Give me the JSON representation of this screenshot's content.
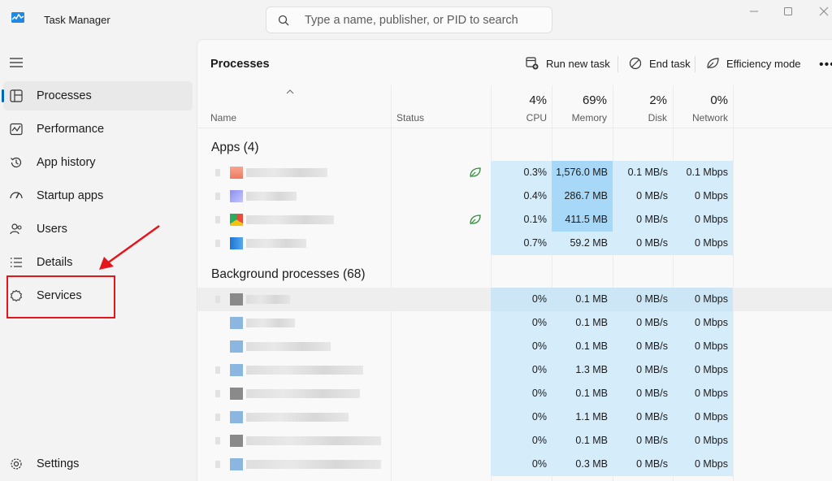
{
  "window": {
    "title": "Task Manager",
    "search_placeholder": "Type a name, publisher, or PID to search"
  },
  "sidebar": {
    "items": [
      {
        "label": "Processes",
        "icon": "processes-icon",
        "selected": true
      },
      {
        "label": "Performance",
        "icon": "performance-icon"
      },
      {
        "label": "App history",
        "icon": "history-icon"
      },
      {
        "label": "Startup apps",
        "icon": "startup-icon"
      },
      {
        "label": "Users",
        "icon": "users-icon"
      },
      {
        "label": "Details",
        "icon": "details-icon"
      },
      {
        "label": "Services",
        "icon": "services-icon"
      }
    ],
    "settings_label": "Settings"
  },
  "toolbar": {
    "page_title": "Processes",
    "run_new_task": "Run new task",
    "end_task": "End task",
    "efficiency_mode": "Efficiency mode",
    "more": "•••"
  },
  "columns": {
    "name": "Name",
    "status": "Status",
    "cpu": {
      "pct": "4%",
      "label": "CPU"
    },
    "memory": {
      "pct": "69%",
      "label": "Memory"
    },
    "disk": {
      "pct": "2%",
      "label": "Disk"
    },
    "network": {
      "pct": "0%",
      "label": "Network"
    }
  },
  "apps": {
    "header": "Apps (4)",
    "rows": [
      {
        "cpu": "0.3%",
        "memory": "1,576.0 MB",
        "disk": "0.1 MB/s",
        "network": "0.1 Mbps",
        "efficiency": true,
        "mem_heat": "high"
      },
      {
        "cpu": "0.4%",
        "memory": "286.7 MB",
        "disk": "0 MB/s",
        "network": "0 Mbps",
        "efficiency": false,
        "mem_heat": "high"
      },
      {
        "cpu": "0.1%",
        "memory": "411.5 MB",
        "disk": "0 MB/s",
        "network": "0 Mbps",
        "efficiency": true,
        "mem_heat": "high"
      },
      {
        "cpu": "0.7%",
        "memory": "59.2 MB",
        "disk": "0 MB/s",
        "network": "0 Mbps",
        "efficiency": false,
        "mem_heat": "low"
      }
    ]
  },
  "background": {
    "header": "Background processes (68)",
    "rows": [
      {
        "cpu": "0%",
        "memory": "0.1 MB",
        "disk": "0 MB/s",
        "network": "0 Mbps"
      },
      {
        "cpu": "0%",
        "memory": "0.1 MB",
        "disk": "0 MB/s",
        "network": "0 Mbps"
      },
      {
        "cpu": "0%",
        "memory": "0.1 MB",
        "disk": "0 MB/s",
        "network": "0 Mbps"
      },
      {
        "cpu": "0%",
        "memory": "1.3 MB",
        "disk": "0 MB/s",
        "network": "0 Mbps"
      },
      {
        "cpu": "0%",
        "memory": "0.1 MB",
        "disk": "0 MB/s",
        "network": "0 Mbps"
      },
      {
        "cpu": "0%",
        "memory": "1.1 MB",
        "disk": "0 MB/s",
        "network": "0 Mbps"
      },
      {
        "cpu": "0%",
        "memory": "0.1 MB",
        "disk": "0 MB/s",
        "network": "0 Mbps"
      },
      {
        "cpu": "0%",
        "memory": "0.3 MB",
        "disk": "0 MB/s",
        "network": "0 Mbps"
      }
    ]
  },
  "colors": {
    "accent": "#0067c0",
    "heat_low": "#d5ecfb",
    "heat_high": "#a8d8f8",
    "annotation": "#e4161b"
  }
}
